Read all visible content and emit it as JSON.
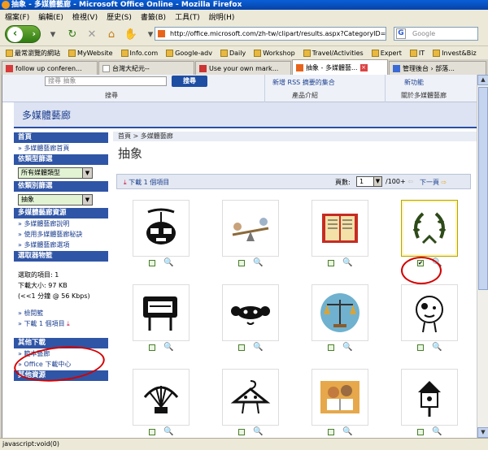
{
  "window": {
    "title": "抽象 - 多媒體藝廊 - Microsoft Office Online - Mozilla Firefox"
  },
  "menu": [
    "檔案(F)",
    "編輯(E)",
    "檢視(V)",
    "歷史(S)",
    "書籤(B)",
    "工具(T)",
    "說明(H)"
  ],
  "nav": {
    "url": "http://office.microsoft.com/zh-tw/clipart/results.aspx?CategoryID=CM",
    "search_placeholder": "Google"
  },
  "bookmarks": [
    "最常瀏覽的網站",
    "MyWebsite",
    "Info.com",
    "Google-adv",
    "Daily",
    "Workshop",
    "Travel/Activities",
    "Expert",
    "IT",
    "Invest&Biz"
  ],
  "tabs": [
    {
      "label": "follow up conferen..."
    },
    {
      "label": "台灣大紀元--"
    },
    {
      "label": "Use your own mark..."
    },
    {
      "label": "抽象 - 多媒體藝..."
    },
    {
      "label": "管理後台 › 部落..."
    }
  ],
  "header": {
    "search_placeholder": "搜尋 抽象",
    "search_button": "搜尋",
    "search_caption": "搜尋",
    "product_caption": "產品介紹",
    "about_caption": "關於多媒體藝廊",
    "rss_link": "新增 RSS 摘要的集合",
    "new_features": "新功能"
  },
  "banner": {
    "title": "多媒體藝廊"
  },
  "sidebar": {
    "section_home": "首頁",
    "home_link": "» 多媒體藝廊首頁",
    "section_type": "依類型篩選",
    "type_value": "所有媒體類型",
    "section_category": "依類別篩選",
    "category_value": "抽象",
    "section_resources": "多媒體藝廊資源",
    "res_items": [
      "» 多媒體藝廊說明",
      "» 使用多媒體藝廊秘訣",
      "» 多媒體藝廊選項"
    ],
    "section_selection": "選取器物籃",
    "selected_label": "選取的項目: 1",
    "size_label": "下載大小: 97 KB",
    "time_label": "(<<1 分鐘 @ 56 Kbps)",
    "view_link": "» 檢閱籃",
    "download_link": "» 下載 1 個項目",
    "section_other": "其他下載",
    "other_items": [
      "» 範本藝廊",
      "» Office 下載中心"
    ],
    "section_more": "其他資源"
  },
  "main": {
    "breadcrumb": "首頁 > 多媒體藝廊",
    "title": "抽象",
    "download_link": "下載 1 個項目",
    "page_label": "頁數:",
    "page_value": "1",
    "page_total": "/100+",
    "next_label": "下一頁"
  },
  "clipart": [
    {
      "name": "robot-face",
      "selected": false
    },
    {
      "name": "seesaw",
      "selected": false
    },
    {
      "name": "book",
      "selected": false
    },
    {
      "name": "laurel-wreath",
      "selected": true
    },
    {
      "name": "projector-sign",
      "selected": false
    },
    {
      "name": "bow-face",
      "selected": false
    },
    {
      "name": "scales",
      "selected": false
    },
    {
      "name": "bubble-face",
      "selected": false
    },
    {
      "name": "shell-ornament",
      "selected": false
    },
    {
      "name": "hanger-figure",
      "selected": false
    },
    {
      "name": "people-reading",
      "selected": false
    },
    {
      "name": "birdhouse",
      "selected": false
    }
  ],
  "status": {
    "text": "javascript:void(0)"
  }
}
